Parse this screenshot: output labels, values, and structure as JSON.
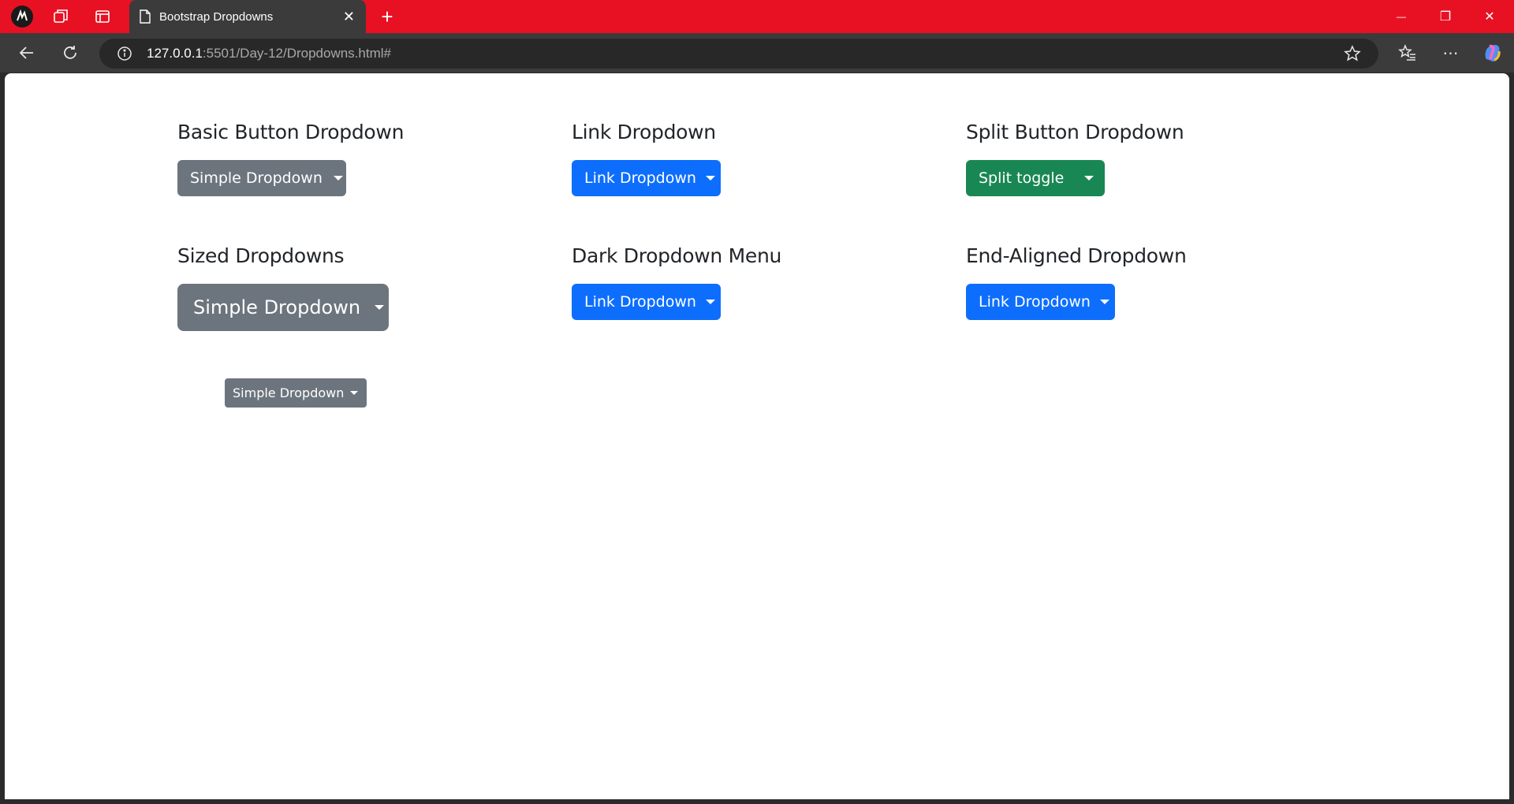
{
  "browser": {
    "tab_title": "Bootstrap Dropdowns",
    "url_host": "127.0.0.1",
    "url_rest": ":5501/Day-12/Dropdowns.html#",
    "tab_close": "✕",
    "new_tab": "+",
    "window_controls": {
      "minimize": "—",
      "restore": "❐",
      "close": "✕"
    }
  },
  "sections": {
    "basic": {
      "heading": "Basic Button Dropdown",
      "button": "Simple Dropdown"
    },
    "link": {
      "heading": "Link Dropdown",
      "button": "Link Dropdown"
    },
    "split": {
      "heading": "Split Button Dropdown",
      "button": "Split toggle"
    },
    "sized": {
      "heading": "Sized Dropdowns",
      "button_large": "Simple Dropdown",
      "button_small": "Simple Dropdown"
    },
    "dark": {
      "heading": "Dark Dropdown Menu",
      "button": "Link Dropdown"
    },
    "end": {
      "heading": "End-Aligned Dropdown",
      "button": "Link Dropdown"
    }
  },
  "colors": {
    "secondary": "#6c757d",
    "primary": "#0d6efd",
    "success": "#198754",
    "browser_accent": "#e81123"
  }
}
